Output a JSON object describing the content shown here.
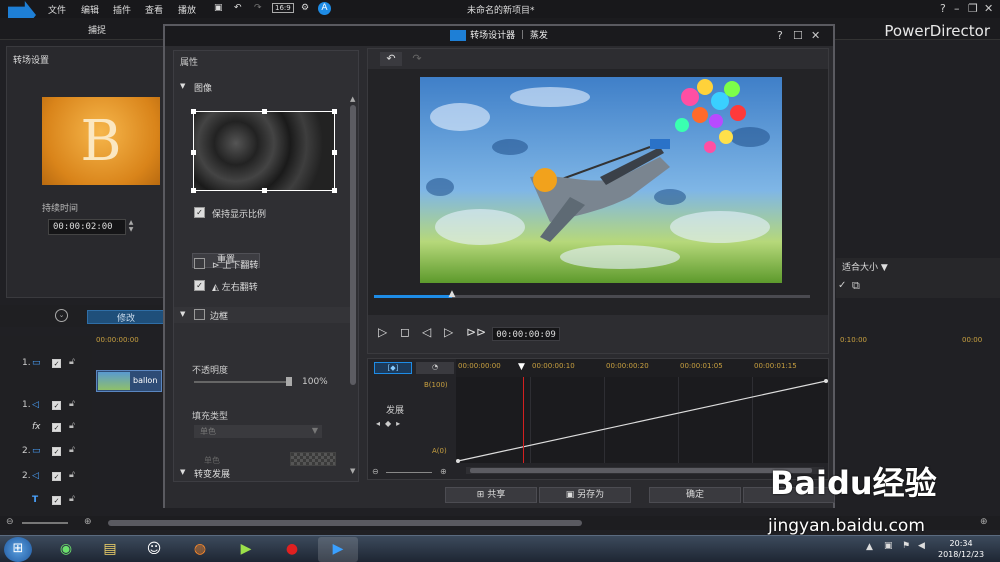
{
  "app": {
    "title": "未命名的新项目*",
    "brand": "PowerDirector",
    "menu": [
      "文件",
      "编辑",
      "插件",
      "查看",
      "播放"
    ],
    "tab_capture": "捕捉",
    "timecode_field": "00:00"
  },
  "left_panel": {
    "title": "转场设置",
    "thumb_letter": "B",
    "duration_label": "持续时间",
    "duration_value": "00:00:02:00"
  },
  "right_strip": {
    "fit_label": "适合大小 ▼"
  },
  "timeline": {
    "modify_label": "修改",
    "ruler_left": "00:00:00:00",
    "ruler_right_a": "0:10:00",
    "ruler_right_b": "00:00",
    "tracks": [
      {
        "num": "1.",
        "icon": "video"
      },
      {
        "num": "1.",
        "icon": "audio"
      },
      {
        "num": "",
        "icon": "fx"
      },
      {
        "num": "2.",
        "icon": "video"
      },
      {
        "num": "2.",
        "icon": "audio"
      },
      {
        "num": "",
        "icon": "title"
      }
    ],
    "clip_label": "ballon"
  },
  "dialog": {
    "title": "转场设计器 ｜ 蒸发",
    "props_title": "属性",
    "section_image": "图像",
    "keep_ratio": "保持显示比例",
    "reset": "重置",
    "flip_v": "上下翻转",
    "flip_h": "左右翻转",
    "section_border": "边框",
    "opacity_label": "不透明度",
    "opacity_value": "100%",
    "opacity_level": 1.0,
    "fill_type_label": "填充类型",
    "fill_select": "单色",
    "color_label": "单色",
    "section_transition": "转变发展",
    "preview_timecode": "00:00:00:09",
    "seek_fraction": 0.18,
    "kf_ticks": [
      "00:00:00:00",
      "00:00:00:10",
      "00:00:00:20",
      "00:00:01:05",
      "00:00:01:15"
    ],
    "kf_track_label": "发展",
    "kf_b": "B(100)",
    "kf_a": "A(0)",
    "buttons": {
      "share": "共享",
      "save_as": "另存为",
      "ok": "确定"
    }
  },
  "taskbar": {
    "time": "20:34",
    "date": "2018/12/23"
  },
  "watermark": {
    "logo": "Baidu经验",
    "url": "jingyan.baidu.com"
  },
  "colors": {
    "accent": "#1e8ce6",
    "playhead": "#d42020",
    "keyframe_text": "#c8a040"
  }
}
